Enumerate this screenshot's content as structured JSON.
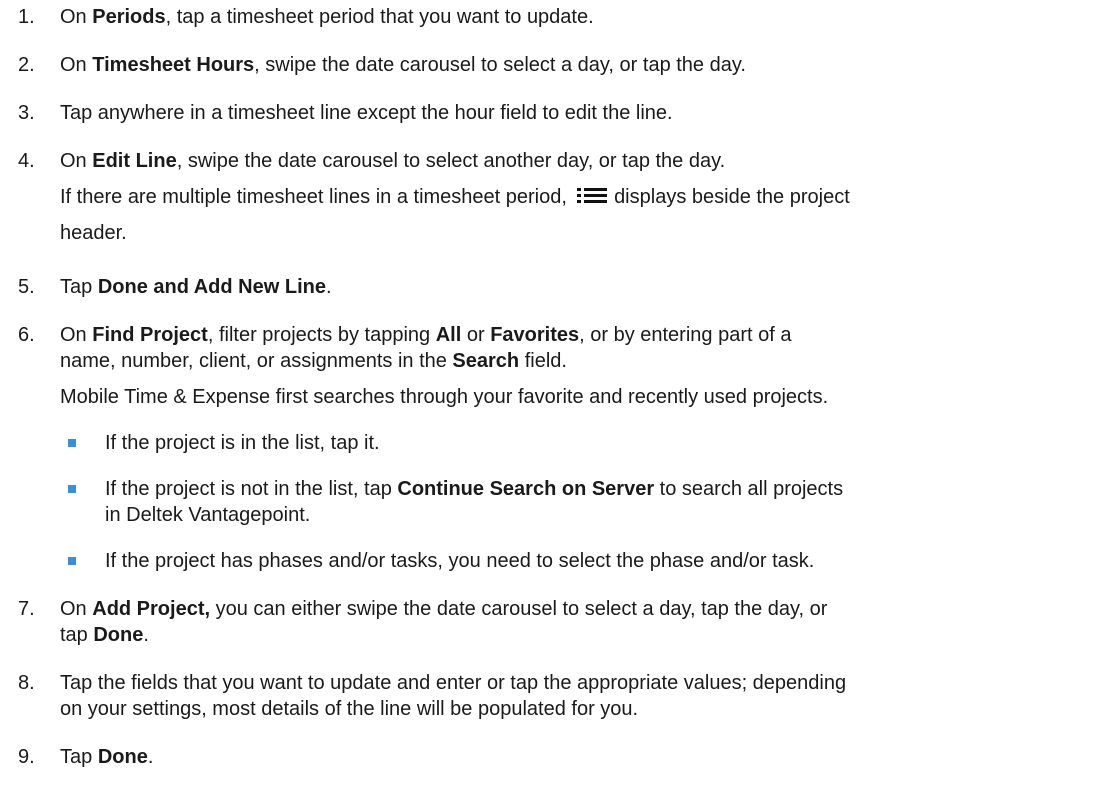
{
  "steps": [
    {
      "num": "1.",
      "parts": [
        [
          "",
          "On "
        ],
        [
          "b",
          "Periods"
        ],
        [
          "",
          ", tap a timesheet period that you want to update."
        ]
      ]
    },
    {
      "num": "2.",
      "parts": [
        [
          "",
          "On "
        ],
        [
          "b",
          "Timesheet Hours"
        ],
        [
          "",
          ", swipe the date carousel to select a day, or tap the day."
        ]
      ]
    },
    {
      "num": "3.",
      "parts": [
        [
          "",
          "Tap anywhere in a timesheet line except the hour field to edit the line."
        ]
      ]
    },
    {
      "num": "4.",
      "parts": [
        [
          "",
          "On "
        ],
        [
          "b",
          "Edit Line"
        ],
        [
          "",
          ", swipe the date carousel to select another day, or tap the day."
        ]
      ]
    },
    {
      "num": "5.",
      "parts": [
        [
          "",
          "Tap "
        ],
        [
          "b",
          "Done and Add New Line"
        ],
        [
          "",
          "."
        ]
      ]
    },
    {
      "num": "6.",
      "line1": [
        [
          "",
          "On "
        ],
        [
          "b",
          "Find Project"
        ],
        [
          "",
          ", filter projects by tapping "
        ],
        [
          "b",
          "All"
        ],
        [
          "",
          " or "
        ],
        [
          "b",
          "Favorites"
        ],
        [
          "",
          ", or by entering part of a"
        ]
      ],
      "line2": [
        [
          "",
          "name, number, client, or assignments in the "
        ],
        [
          "b",
          "Search"
        ],
        [
          "",
          " field."
        ]
      ]
    },
    {
      "num": "7.",
      "line1": [
        [
          "",
          "On "
        ],
        [
          "b",
          "Add Project,"
        ],
        [
          "",
          " you can either swipe the date carousel to select a day, tap the day, or"
        ]
      ],
      "line2": [
        [
          "",
          "tap "
        ],
        [
          "b",
          "Done"
        ],
        [
          "",
          "."
        ]
      ]
    },
    {
      "num": "8.",
      "line1": [
        [
          "",
          "Tap the fields that you want to update and enter or tap the appropriate values; depending"
        ]
      ],
      "line2": [
        [
          "",
          "on your settings, most details of the line will be populated for you."
        ]
      ]
    },
    {
      "num": "9.",
      "parts": [
        [
          "",
          "Tap "
        ],
        [
          "b",
          "Done"
        ],
        [
          "",
          "."
        ]
      ]
    }
  ],
  "note4": {
    "before": "If there are multiple timesheet lines in a timesheet period,",
    "icon": "list-icon",
    "after": "displays beside the project",
    "line2": "header."
  },
  "note6": "Mobile Time & Expense first searches through your favorite and recently used projects.",
  "bullets": [
    {
      "l1": [
        [
          "",
          "If the project is in the list, tap it."
        ]
      ]
    },
    {
      "l1": [
        [
          "",
          "If the project is not in the list, tap "
        ],
        [
          "b",
          "Continue Search on Server"
        ],
        [
          "",
          " to search all projects"
        ]
      ],
      "l2": [
        [
          "",
          "in Deltek Vantagepoint."
        ]
      ]
    },
    {
      "l1": [
        [
          "",
          "If the project has phases and/or tasks, you need to select the phase and/or task."
        ]
      ]
    }
  ],
  "colors": {
    "bullet": "#3b8fd4",
    "text": "#1a1a1a"
  }
}
